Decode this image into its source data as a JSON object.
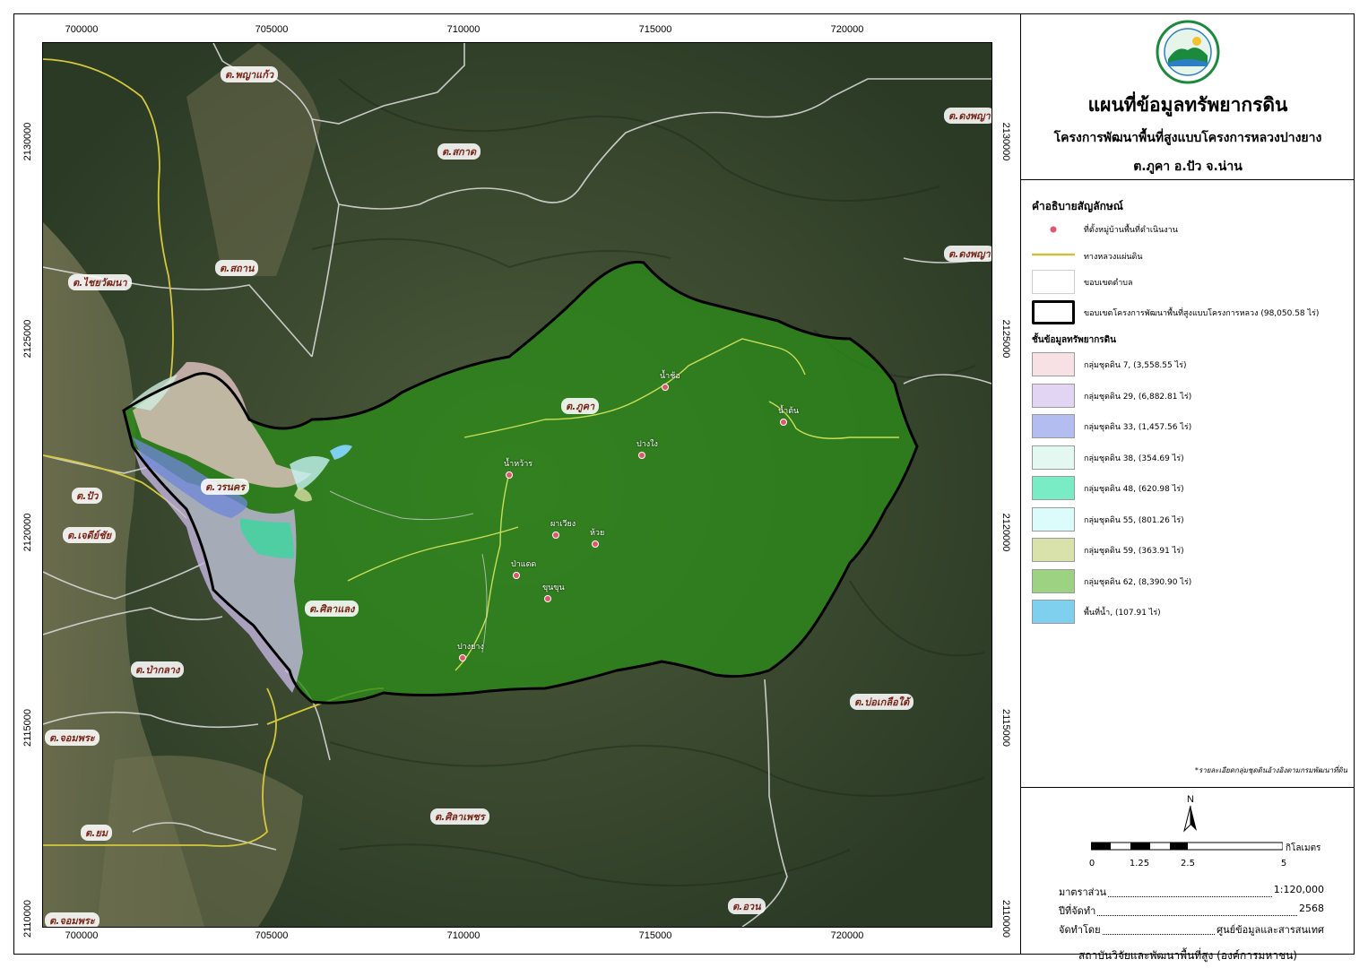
{
  "title": {
    "main": "แผนที่ข้อมูลทรัพยากรดิน",
    "project": "โครงการพัฒนาพื้นที่สูงแบบโครงการหลวงปางยาง",
    "location": "ต.ภูคา อ.ปัว จ.น่าน"
  },
  "logo": {
    "icon": "institute-seal-logo",
    "colors": [
      "#1b8a3c",
      "#2c7fc4"
    ]
  },
  "axes": {
    "x_ticks": [
      "700000",
      "705000",
      "710000",
      "715000",
      "720000"
    ],
    "y_ticks": [
      "2130000",
      "2125000",
      "2120000",
      "2115000",
      "2110000"
    ]
  },
  "legend": {
    "heading": "คำอธิบายสัญลักษณ์",
    "symbols": [
      {
        "label": "ที่ตั้งหมู่บ้านพื้นที่ดำเนินงาน",
        "icon": "village-point-icon",
        "color": "#e0566c"
      },
      {
        "label": "ทางหลวงแผ่นดิน",
        "icon": "highway-line-icon",
        "color": "#c9c23a"
      },
      {
        "label": "ขอบเขตตำบล",
        "icon": "subdistrict-boundary-icon",
        "color": "#cfcfcf"
      },
      {
        "label": "ขอบเขตโครงการพัฒนาพื้นที่สูงแบบโครงการหลวง (98,050.58 ไร่)",
        "icon": "project-boundary-icon",
        "color": "#000000"
      }
    ],
    "soil_heading": "ชั้นข้อมูลทรัพยากรดิน",
    "soil_groups": [
      {
        "label": "กลุ่มชุดดิน  7, (3,558.55 ไร่)",
        "color": "#f7e1e4"
      },
      {
        "label": "กลุ่มชุดดิน  29, (6,882.81 ไร่)",
        "color": "#e2d4f3"
      },
      {
        "label": "กลุ่มชุดดิน  33, (1,457.56 ไร่)",
        "color": "#b3bdf0"
      },
      {
        "label": "กลุ่มชุดดิน  38, (354.69 ไร่)",
        "color": "#e2f8f0"
      },
      {
        "label": "กลุ่มชุดดิน  48, (620.98 ไร่)",
        "color": "#79ecc6"
      },
      {
        "label": "กลุ่มชุดดิน  55, (801.26 ไร่)",
        "color": "#dcfbfb"
      },
      {
        "label": "กลุ่มชุดดิน  59, (363.91 ไร่)",
        "color": "#d9e2ab"
      },
      {
        "label": "กลุ่มชุดดิน  62, (8,390.90 ไร่)",
        "color": "#9ed283"
      },
      {
        "label": "พื้นที่น้ำ, (107.91 ไร่)",
        "color": "#7fd0ef"
      }
    ],
    "note": "*รายละเอียดกลุ่มชุดดินอ้างอิงตามกรมพัฒนาที่ดิน"
  },
  "north_arrow": {
    "label": "N",
    "icon": "north-arrow-icon"
  },
  "scale_bar": {
    "unit": "กิโลเมตร",
    "ticks": [
      "0",
      "1.25",
      "2.5",
      "5"
    ]
  },
  "info": {
    "scale_label": "มาตราส่วน",
    "scale_value": "1:120,000",
    "year_label": "ปีที่จัดทำ",
    "year_value": "2568",
    "by_label": "จัดทำโดย",
    "by_value": "ศูนย์ข้อมูลและสารสนเทศ",
    "institute": "สถาบันวิจัยและพัฒนาพื้นที่สูง (องค์การมหาชน)"
  },
  "map": {
    "subdistricts": [
      "ต.พญาแก้ว",
      "ต.ดงพญา",
      "ต.สกาด",
      "ต.ไชยวัฒนา",
      "ต.สถาน",
      "ต.ดงพญา",
      "ต.ภูคา",
      "ต.วรนคร",
      "ต.ปัว",
      "ต.เจดีย์ชัย",
      "ต.ศิลาแลง",
      "ต.ป่ากลาง",
      "ต.บ่อเกลือใต้",
      "ต.จอมพระ",
      "ต.ศิลาเพชร",
      "ต.ยม",
      "ต.อวน",
      "ต.จอมพระ"
    ],
    "villages": [
      "น้ำช้อ",
      "น้ำต้น",
      "ปางใง",
      "น้ำหว้าร",
      "ผาเวียง",
      "ห้วย",
      "ป่าแดด",
      "ขุนขุน",
      "ปางยาง"
    ]
  }
}
